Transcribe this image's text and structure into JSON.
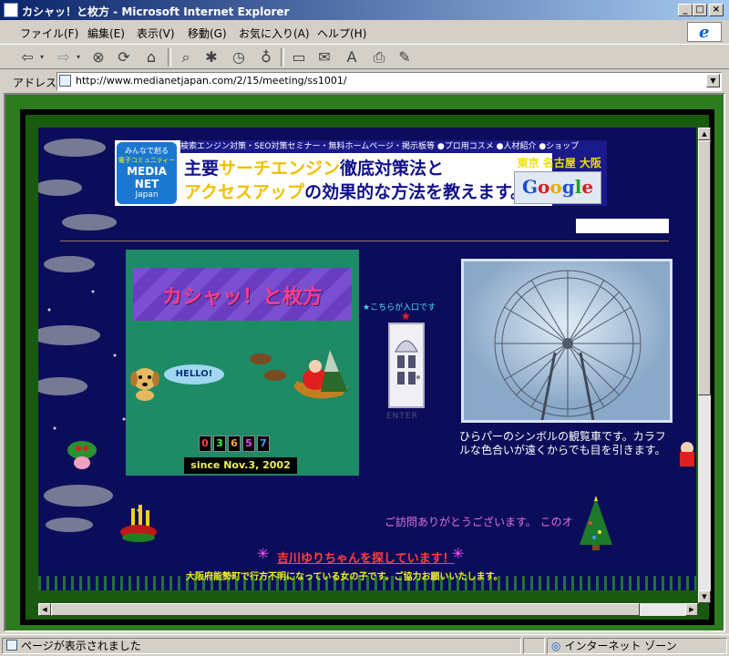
{
  "window": {
    "title": "カシャッ！と枚方 - Microsoft Internet Explorer",
    "minimize_glyph": "_",
    "maximize_glyph": "□",
    "close_glyph": "×"
  },
  "menu": [
    "ファイル(F)",
    "編集(E)",
    "表示(V)",
    "移動(G)",
    "お気に入り(A)",
    "ヘルプ(H)"
  ],
  "toolbar": {
    "icons": [
      "back-icon",
      "forward-icon",
      "stop-icon",
      "refresh-icon",
      "home-icon",
      "search-icon",
      "favorites-icon",
      "history-icon",
      "channels-icon",
      "fullscreen-icon",
      "mail-icon",
      "font-icon",
      "print-icon",
      "edit-icon"
    ]
  },
  "address": {
    "label": "アドレス",
    "url": "http://www.medianetjapan.com/2/15/meeting/ss1001/"
  },
  "banner": {
    "top_links": "検索エンジン対策・SEO対策セミナー・無料ホームページ・掲示板等 ●プロ用コスメ ●人材紹介 ●ショップ",
    "logo_line1": "みんなで創る",
    "logo_line2": "電子コミュニティー",
    "logo_line3": "MEDIA",
    "logo_line4": "NET",
    "logo_line5": "Japan",
    "line1_a": "主要",
    "line1_b": "サーチエンジン",
    "line1_c": "徹底対策法と",
    "line2_a": "アクセスアップ",
    "line2_b": "の効果的な方法を教えます。",
    "cities": "東京 名古屋 大阪",
    "google": "Google"
  },
  "main": {
    "site_title": "カシャッ！と枚方",
    "hello": "HELLO!",
    "counter_digits": [
      "0",
      "3",
      "6",
      "5",
      "7"
    ],
    "since": "since Nov.3, 2002",
    "entrance_label": "★こちらが入口です",
    "enter": "ENTER",
    "ferris_caption": "ひらパーのシンボルの観覧車です。カラフルな色合いが遠くからでも目を引きます。",
    "welcome": "ご訪問ありがとうございます。 このオ",
    "missing_title": "吉川ゆりちゃんを探しています！",
    "missing_star": "✳",
    "missing_sub": "大阪府能勢町で行方不明になっている女の子です。ご協力お願いいたします。"
  },
  "status": {
    "text": "ページが表示されました",
    "zone": "インターネット ゾーン"
  },
  "colors": {
    "page_bg": "#0c0d5a",
    "frame_green": "#2d7a1f",
    "accent_pink": "#ff3c8c"
  }
}
